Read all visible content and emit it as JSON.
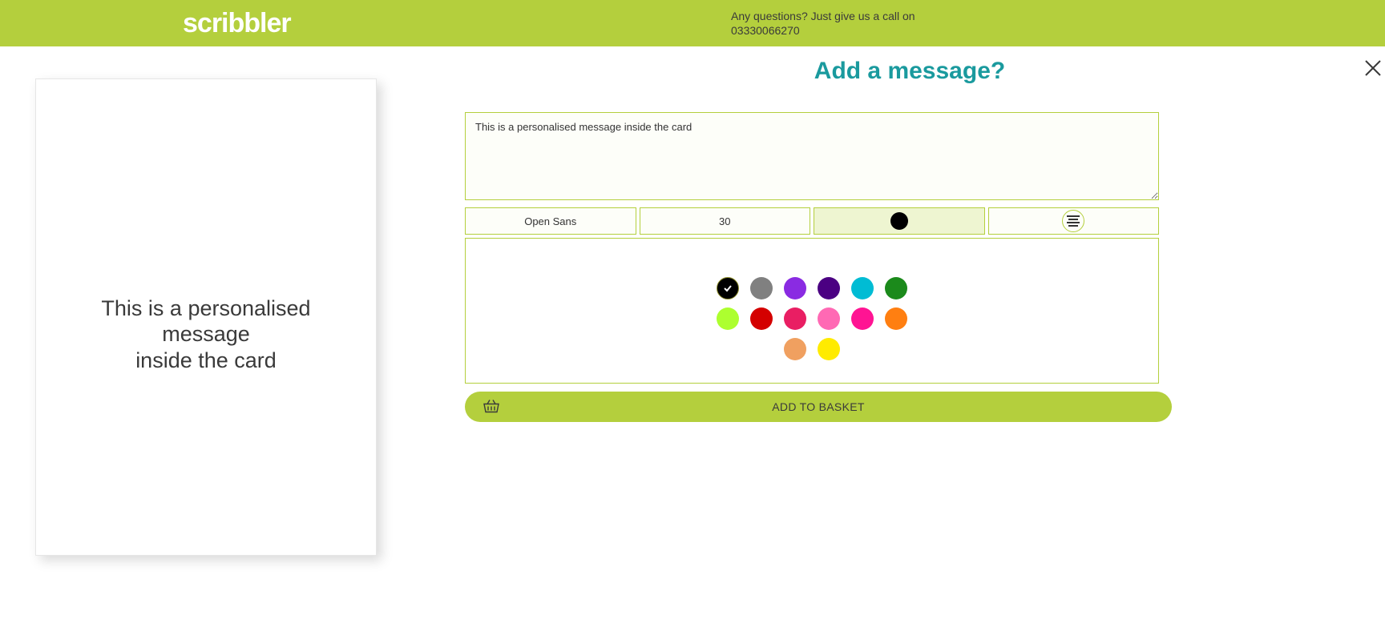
{
  "header": {
    "logo_text": "scribbler",
    "question_line": "Any questions? Just give us a call on",
    "phone": "03330066270"
  },
  "preview": {
    "card_message": "This is a personalised message inside the card"
  },
  "editor": {
    "title": "Add a message?",
    "textarea_value": "This is a personalised message inside the card",
    "toolbar": {
      "font_label": "Open Sans",
      "size_label": "30",
      "current_color": "#000000"
    },
    "palette": {
      "row1": [
        {
          "hex": "#000000",
          "selected": true
        },
        {
          "hex": "#808080",
          "selected": false
        },
        {
          "hex": "#8A2BE2",
          "selected": false
        },
        {
          "hex": "#4B0082",
          "selected": false
        },
        {
          "hex": "#00BCD4",
          "selected": false
        },
        {
          "hex": "#1B8A1B",
          "selected": false
        }
      ],
      "row2": [
        {
          "hex": "#ADFF2F",
          "selected": false
        },
        {
          "hex": "#D40000",
          "selected": false
        },
        {
          "hex": "#E91E63",
          "selected": false
        },
        {
          "hex": "#FF69B4",
          "selected": false
        },
        {
          "hex": "#FF1493",
          "selected": false
        },
        {
          "hex": "#FF7F11",
          "selected": false
        }
      ],
      "row3": [
        {
          "hex": "#F0A060",
          "selected": false
        },
        {
          "hex": "#FFEB00",
          "selected": false
        }
      ]
    },
    "add_to_basket_label": "ADD TO BASKET"
  }
}
